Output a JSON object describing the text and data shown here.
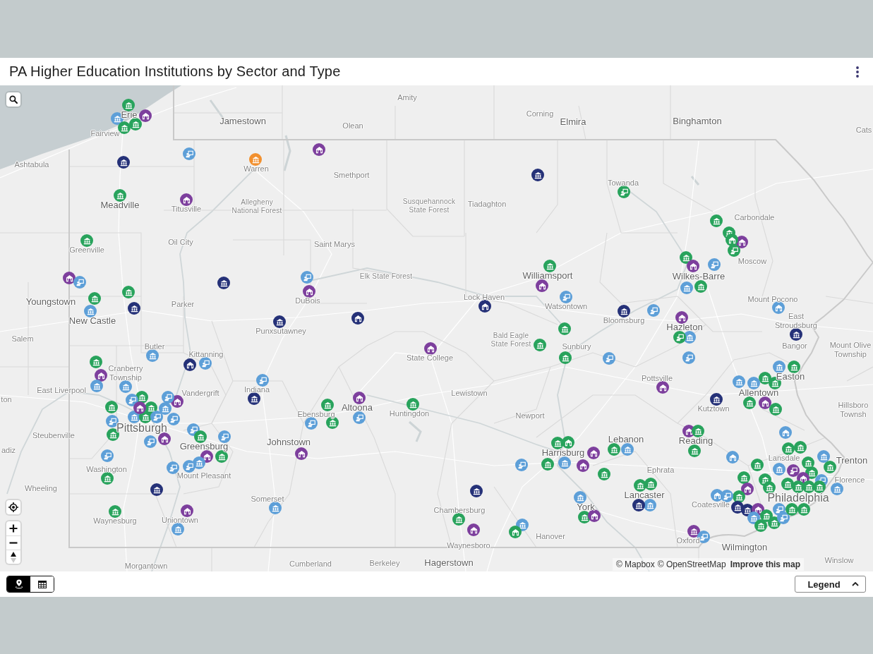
{
  "header": {
    "title": "PA Higher Education Institutions by Sector and Type"
  },
  "map": {
    "places": [
      {
        "name": "Amity",
        "kind": "town"
      },
      {
        "name": "Erie",
        "kind": "city"
      },
      {
        "name": "Corning",
        "kind": "town"
      },
      {
        "name": "Jamestown",
        "kind": "city"
      },
      {
        "name": "Olean",
        "kind": "town"
      },
      {
        "name": "Elmira",
        "kind": "city"
      },
      {
        "name": "Binghamton",
        "kind": "city"
      },
      {
        "name": "Fairview",
        "kind": "town"
      },
      {
        "name": "Cats",
        "kind": "town"
      },
      {
        "name": "Ashtabula",
        "kind": "town"
      },
      {
        "name": "Warren",
        "kind": "town"
      },
      {
        "name": "Smethport",
        "kind": "town"
      },
      {
        "name": "Towanda",
        "kind": "town"
      },
      {
        "name": "Meadville",
        "kind": "city"
      },
      {
        "name": "Titusville",
        "kind": "town"
      },
      {
        "name": "Allegheny\nNational Forest",
        "kind": "forest"
      },
      {
        "name": "Susquehannock\nState Forest",
        "kind": "forest"
      },
      {
        "name": "Tiadaghton",
        "kind": "town"
      },
      {
        "name": "Carbondale",
        "kind": "town"
      },
      {
        "name": "Oil City",
        "kind": "town"
      },
      {
        "name": "Saint Marys",
        "kind": "town"
      },
      {
        "name": "Greenville",
        "kind": "town"
      },
      {
        "name": "Moscow",
        "kind": "town"
      },
      {
        "name": "Elk State Forest",
        "kind": "forest"
      },
      {
        "name": "Williamsport",
        "kind": "city"
      },
      {
        "name": "Wilkes-Barre",
        "kind": "city"
      },
      {
        "name": "Youngstown",
        "kind": "city"
      },
      {
        "name": "Parker",
        "kind": "town"
      },
      {
        "name": "DuBois",
        "kind": "town"
      },
      {
        "name": "Lock Haven",
        "kind": "town"
      },
      {
        "name": "Mount Pocono",
        "kind": "town"
      },
      {
        "name": "Watsontown",
        "kind": "town"
      },
      {
        "name": "New Castle",
        "kind": "city"
      },
      {
        "name": "Bloomsburg",
        "kind": "town"
      },
      {
        "name": "Hazleton",
        "kind": "city"
      },
      {
        "name": "East\nStroudsburg",
        "kind": "town"
      },
      {
        "name": "Punxsutawney",
        "kind": "town"
      },
      {
        "name": "Salem",
        "kind": "town"
      },
      {
        "name": "Butler",
        "kind": "town"
      },
      {
        "name": "Bald Eagle\nState Forest",
        "kind": "forest"
      },
      {
        "name": "Sunbury",
        "kind": "town"
      },
      {
        "name": "Bangor",
        "kind": "town"
      },
      {
        "name": "Kittanning",
        "kind": "town"
      },
      {
        "name": "State College",
        "kind": "town"
      },
      {
        "name": "Mount Olive\nTownship",
        "kind": "town"
      },
      {
        "name": "Cranberry\nTownship",
        "kind": "town"
      },
      {
        "name": "Pottsville",
        "kind": "town"
      },
      {
        "name": "Easton",
        "kind": "city"
      },
      {
        "name": "East Liverpool",
        "kind": "town"
      },
      {
        "name": "Vandergrift",
        "kind": "town"
      },
      {
        "name": "Indiana",
        "kind": "town"
      },
      {
        "name": "Lewistown",
        "kind": "town"
      },
      {
        "name": "Allentown",
        "kind": "city"
      },
      {
        "name": "ton",
        "kind": "town"
      },
      {
        "name": "Altoona",
        "kind": "city"
      },
      {
        "name": "Kutztown",
        "kind": "town"
      },
      {
        "name": "Ebensburg",
        "kind": "town"
      },
      {
        "name": "Huntingdon",
        "kind": "town"
      },
      {
        "name": "Newport",
        "kind": "town"
      },
      {
        "name": "Hillsboro\nTownsh",
        "kind": "town"
      },
      {
        "name": "Pittsburgh",
        "kind": "major"
      },
      {
        "name": "Steubenville",
        "kind": "town"
      },
      {
        "name": "Greensburg",
        "kind": "city"
      },
      {
        "name": "Johnstown",
        "kind": "city"
      },
      {
        "name": "Lebanon",
        "kind": "city"
      },
      {
        "name": "Reading",
        "kind": "city"
      },
      {
        "name": "adiz",
        "kind": "town"
      },
      {
        "name": "Harrisburg",
        "kind": "city"
      },
      {
        "name": "Lansdale",
        "kind": "town"
      },
      {
        "name": "Trenton",
        "kind": "city"
      },
      {
        "name": "Washington",
        "kind": "town"
      },
      {
        "name": "Ephrata",
        "kind": "town"
      },
      {
        "name": "Mount Pleasant",
        "kind": "town"
      },
      {
        "name": "Florence",
        "kind": "town"
      },
      {
        "name": "Wheeling",
        "kind": "town"
      },
      {
        "name": "Somerset",
        "kind": "town"
      },
      {
        "name": "Lancaster",
        "kind": "city"
      },
      {
        "name": "Philadelphia",
        "kind": "major"
      },
      {
        "name": "Chambersburg",
        "kind": "town"
      },
      {
        "name": "York",
        "kind": "city"
      },
      {
        "name": "Coatesville",
        "kind": "town"
      },
      {
        "name": "Waynesburg",
        "kind": "town"
      },
      {
        "name": "Uniontown",
        "kind": "town"
      },
      {
        "name": "Hanover",
        "kind": "town"
      },
      {
        "name": "Oxford",
        "kind": "town"
      },
      {
        "name": "Waynesboro",
        "kind": "town"
      },
      {
        "name": "Wilmington",
        "kind": "city"
      },
      {
        "name": "Morgantown",
        "kind": "town"
      },
      {
        "name": "Cumberland",
        "kind": "town"
      },
      {
        "name": "Berkeley",
        "kind": "town"
      },
      {
        "name": "Hagerstown",
        "kind": "city"
      },
      {
        "name": "Winslow",
        "kind": "town"
      }
    ],
    "markers": [
      {
        "kind": "columns",
        "color": "#5d9fd8"
      },
      {
        "kind": "columns",
        "color": "#28a35c"
      },
      {
        "kind": "columns",
        "color": "#28a35c"
      },
      {
        "kind": "columns",
        "color": "#28a35c"
      },
      {
        "kind": "arched",
        "color": "#7d3f9d"
      },
      {
        "kind": "columns",
        "color": "#253178"
      },
      {
        "kind": "presenter",
        "color": "#5d9fd8"
      },
      {
        "kind": "columns",
        "color": "#f2902e"
      },
      {
        "kind": "arched",
        "color": "#7d3f9d"
      },
      {
        "kind": "columns",
        "color": "#253178"
      },
      {
        "kind": "presenter",
        "color": "#28a35c"
      },
      {
        "kind": "columns",
        "color": "#28a35c"
      },
      {
        "kind": "arched",
        "color": "#7d3f9d"
      },
      {
        "kind": "columns",
        "color": "#28a35c"
      },
      {
        "kind": "columns",
        "color": "#28a35c"
      },
      {
        "kind": "arched",
        "color": "#7d3f9d"
      },
      {
        "kind": "arched",
        "color": "#28a35c"
      },
      {
        "kind": "presenter",
        "color": "#28a35c"
      },
      {
        "kind": "columns",
        "color": "#28a35c"
      },
      {
        "kind": "columns",
        "color": "#28a35c"
      },
      {
        "kind": "arched",
        "color": "#7d3f9d"
      },
      {
        "kind": "presenter",
        "color": "#5d9fd8"
      },
      {
        "kind": "columns",
        "color": "#28a35c"
      },
      {
        "kind": "columns",
        "color": "#5d9fd8"
      },
      {
        "kind": "arched",
        "color": "#7d3f9d"
      },
      {
        "kind": "columns",
        "color": "#28a35c"
      },
      {
        "kind": "arched",
        "color": "#253178"
      },
      {
        "kind": "arched",
        "color": "#7d3f9d"
      },
      {
        "kind": "presenter",
        "color": "#5d9fd8"
      },
      {
        "kind": "columns",
        "color": "#253178"
      },
      {
        "kind": "presenter",
        "color": "#5d9fd8"
      },
      {
        "kind": "columns",
        "color": "#28a35c"
      },
      {
        "kind": "columns",
        "color": "#28a35c"
      },
      {
        "kind": "columns",
        "color": "#253178"
      },
      {
        "kind": "arched",
        "color": "#7d3f9d"
      },
      {
        "kind": "presenter",
        "color": "#5d9fd8"
      },
      {
        "kind": "columns",
        "color": "#5d9fd8"
      },
      {
        "kind": "arched",
        "color": "#253178"
      },
      {
        "kind": "columns",
        "color": "#253178"
      },
      {
        "kind": "columns",
        "color": "#253178"
      },
      {
        "kind": "presenter",
        "color": "#5d9fd8"
      },
      {
        "kind": "arched",
        "color": "#7d3f9d"
      },
      {
        "kind": "columns",
        "color": "#5d9fd8"
      },
      {
        "kind": "presenter",
        "color": "#28a35c"
      },
      {
        "kind": "arched",
        "color": "#5d9fd8"
      },
      {
        "kind": "columns",
        "color": "#253178"
      },
      {
        "kind": "columns",
        "color": "#28a35c"
      },
      {
        "kind": "columns",
        "color": "#28a35c"
      },
      {
        "kind": "columns",
        "color": "#28a35c"
      },
      {
        "kind": "presenter",
        "color": "#5d9fd8"
      },
      {
        "kind": "presenter",
        "color": "#5d9fd8"
      },
      {
        "kind": "columns",
        "color": "#28a35c"
      },
      {
        "kind": "arched",
        "color": "#7d3f9d"
      },
      {
        "kind": "columns",
        "color": "#5d9fd8"
      },
      {
        "kind": "columns",
        "color": "#5d9fd8"
      },
      {
        "kind": "arched",
        "color": "#253178"
      },
      {
        "kind": "presenter",
        "color": "#5d9fd8"
      },
      {
        "kind": "arched",
        "color": "#7d3f9d"
      },
      {
        "kind": "columns",
        "color": "#5d9fd8"
      },
      {
        "kind": "columns",
        "color": "#28a35c"
      },
      {
        "kind": "presenter",
        "color": "#5d9fd8"
      },
      {
        "kind": "arched",
        "color": "#7d3f9d"
      },
      {
        "kind": "presenter",
        "color": "#5d9fd8"
      },
      {
        "kind": "columns",
        "color": "#28a35c"
      },
      {
        "kind": "columns",
        "color": "#28a35c"
      },
      {
        "kind": "presenter",
        "color": "#5d9fd8"
      },
      {
        "kind": "columns",
        "color": "#5d9fd8"
      },
      {
        "kind": "columns",
        "color": "#28a35c"
      },
      {
        "kind": "columns",
        "color": "#28a35c"
      },
      {
        "kind": "arched",
        "color": "#7d3f9d"
      },
      {
        "kind": "presenter",
        "color": "#5d9fd8"
      },
      {
        "kind": "columns",
        "color": "#5d9fd8"
      },
      {
        "kind": "presenter",
        "color": "#5d9fd8"
      },
      {
        "kind": "presenter",
        "color": "#5d9fd8"
      },
      {
        "kind": "presenter",
        "color": "#5d9fd8"
      },
      {
        "kind": "arched",
        "color": "#7d3f9d"
      },
      {
        "kind": "columns",
        "color": "#28a35c"
      },
      {
        "kind": "arched",
        "color": "#7d3f9d"
      },
      {
        "kind": "columns",
        "color": "#28a35c"
      },
      {
        "kind": "presenter",
        "color": "#5d9fd8"
      },
      {
        "kind": "columns",
        "color": "#5d9fd8"
      },
      {
        "kind": "presenter",
        "color": "#5d9fd8"
      },
      {
        "kind": "presenter",
        "color": "#5d9fd8"
      },
      {
        "kind": "presenter",
        "color": "#5d9fd8"
      },
      {
        "kind": "columns",
        "color": "#28a35c"
      },
      {
        "kind": "columns",
        "color": "#253178"
      },
      {
        "kind": "presenter",
        "color": "#5d9fd8"
      },
      {
        "kind": "columns",
        "color": "#253178"
      },
      {
        "kind": "columns",
        "color": "#5d9fd8"
      },
      {
        "kind": "arched",
        "color": "#7d3f9d"
      },
      {
        "kind": "columns",
        "color": "#28a35c"
      },
      {
        "kind": "columns",
        "color": "#5d9fd8"
      },
      {
        "kind": "arched",
        "color": "#7d3f9d"
      },
      {
        "kind": "columns",
        "color": "#28a35c"
      },
      {
        "kind": "presenter",
        "color": "#5d9fd8"
      },
      {
        "kind": "columns",
        "color": "#28a35c"
      },
      {
        "kind": "arched",
        "color": "#7d3f9d"
      },
      {
        "kind": "presenter",
        "color": "#5d9fd8"
      },
      {
        "kind": "columns",
        "color": "#28a35c"
      },
      {
        "kind": "columns",
        "color": "#28a35c"
      },
      {
        "kind": "arched",
        "color": "#28a35c"
      },
      {
        "kind": "columns",
        "color": "#5d9fd8"
      },
      {
        "kind": "arched",
        "color": "#7d3f9d"
      },
      {
        "kind": "presenter",
        "color": "#5d9fd8"
      },
      {
        "kind": "columns",
        "color": "#28a35c"
      },
      {
        "kind": "arched",
        "color": "#7d3f9d"
      },
      {
        "kind": "columns",
        "color": "#28a35c"
      },
      {
        "kind": "columns",
        "color": "#28a35c"
      },
      {
        "kind": "columns",
        "color": "#5d9fd8"
      },
      {
        "kind": "arched",
        "color": "#7d3f9d"
      },
      {
        "kind": "columns",
        "color": "#253178"
      },
      {
        "kind": "arched",
        "color": "#7d3f9d"
      },
      {
        "kind": "columns",
        "color": "#28a35c"
      },
      {
        "kind": "columns",
        "color": "#28a35c"
      },
      {
        "kind": "columns",
        "color": "#5d9fd8"
      },
      {
        "kind": "columns",
        "color": "#28a35c"
      },
      {
        "kind": "columns",
        "color": "#5d9fd8"
      },
      {
        "kind": "columns",
        "color": "#28a35c"
      },
      {
        "kind": "columns",
        "color": "#5d9fd8"
      },
      {
        "kind": "columns",
        "color": "#28a35c"
      },
      {
        "kind": "arched",
        "color": "#7d3f9d"
      },
      {
        "kind": "columns",
        "color": "#28a35c"
      },
      {
        "kind": "columns",
        "color": "#28a35c"
      },
      {
        "kind": "arched",
        "color": "#5d9fd8"
      },
      {
        "kind": "columns",
        "color": "#28a35c"
      },
      {
        "kind": "arched",
        "color": "#5d9fd8"
      },
      {
        "kind": "columns",
        "color": "#5d9fd8"
      },
      {
        "kind": "columns",
        "color": "#28a35c"
      },
      {
        "kind": "columns",
        "color": "#28a35c"
      },
      {
        "kind": "columns",
        "color": "#5d9fd8"
      },
      {
        "kind": "presenter",
        "color": "#7d3f9d"
      },
      {
        "kind": "columns",
        "color": "#28a35c"
      },
      {
        "kind": "columns",
        "color": "#28a35c"
      },
      {
        "kind": "columns",
        "color": "#28a35c"
      },
      {
        "kind": "columns",
        "color": "#5d9fd8"
      },
      {
        "kind": "presenter",
        "color": "#5d9fd8"
      },
      {
        "kind": "arched",
        "color": "#7d3f9d"
      },
      {
        "kind": "columns",
        "color": "#28a35c"
      },
      {
        "kind": "columns",
        "color": "#28a35c"
      },
      {
        "kind": "columns",
        "color": "#28a35c"
      },
      {
        "kind": "columns",
        "color": "#28a35c"
      },
      {
        "kind": "columns",
        "color": "#28a35c"
      },
      {
        "kind": "arched",
        "color": "#7d3f9d"
      },
      {
        "kind": "columns",
        "color": "#28a35c"
      },
      {
        "kind": "columns",
        "color": "#28a35c"
      },
      {
        "kind": "arched",
        "color": "#5d9fd8"
      },
      {
        "kind": "presenter",
        "color": "#5d9fd8"
      },
      {
        "kind": "columns",
        "color": "#253178"
      },
      {
        "kind": "columns",
        "color": "#253178"
      },
      {
        "kind": "arched",
        "color": "#7d3f9d"
      },
      {
        "kind": "columns",
        "color": "#5d9fd8"
      },
      {
        "kind": "columns",
        "color": "#28a35c"
      },
      {
        "kind": "columns",
        "color": "#28a35c"
      },
      {
        "kind": "columns",
        "color": "#28a35c"
      },
      {
        "kind": "presenter",
        "color": "#5d9fd8"
      },
      {
        "kind": "presenter",
        "color": "#5d9fd8"
      },
      {
        "kind": "columns",
        "color": "#28a35c"
      },
      {
        "kind": "columns",
        "color": "#28a35c"
      },
      {
        "kind": "columns",
        "color": "#28a35c"
      },
      {
        "kind": "columns",
        "color": "#28a35c"
      },
      {
        "kind": "columns",
        "color": "#28a35c"
      },
      {
        "kind": "columns",
        "color": "#5d9fd8"
      },
      {
        "kind": "columns",
        "color": "#253178"
      },
      {
        "kind": "columns",
        "color": "#5d9fd8"
      },
      {
        "kind": "columns",
        "color": "#28a35c"
      },
      {
        "kind": "arched",
        "color": "#7d3f9d"
      },
      {
        "kind": "columns",
        "color": "#253178"
      },
      {
        "kind": "columns",
        "color": "#28a35c"
      },
      {
        "kind": "arched",
        "color": "#7d3f9d"
      },
      {
        "kind": "columns",
        "color": "#5d9fd8"
      },
      {
        "kind": "arched",
        "color": "#28a35c"
      },
      {
        "kind": "columns",
        "color": "#7d3f9d"
      },
      {
        "kind": "presenter",
        "color": "#5d9fd8"
      }
    ],
    "attribution": [
      {
        "text": "© Mapbox",
        "kind": "link"
      },
      {
        "text": "© OpenStreetMap",
        "kind": "link"
      },
      {
        "text": "Improve this map",
        "kind": "feedback_link"
      }
    ]
  },
  "footer": {
    "views": [
      {
        "kind": "map",
        "selected": true
      },
      {
        "kind": "table",
        "selected": false
      }
    ],
    "legend_button": {
      "label": "Legend"
    }
  }
}
